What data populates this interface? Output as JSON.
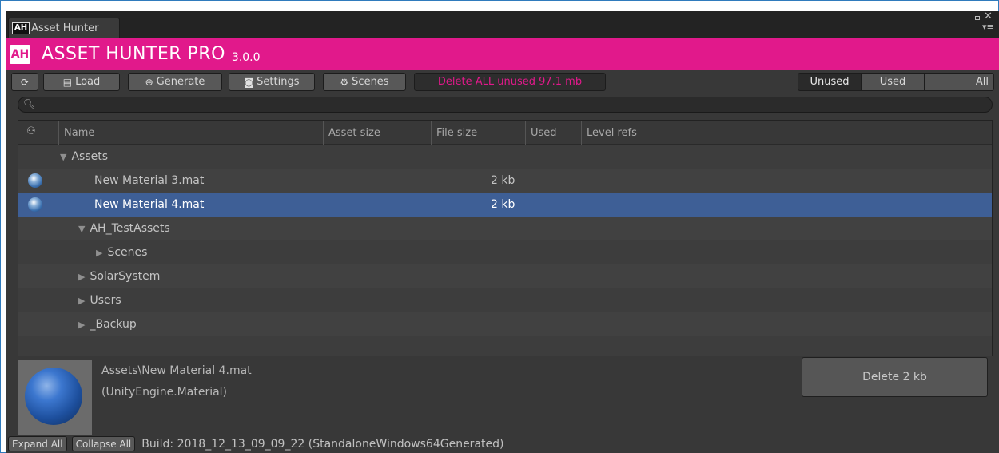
{
  "tab": {
    "badge": "AH",
    "title": "Asset Hunter"
  },
  "header": {
    "logo": "AH",
    "title": "ASSET HUNTER PRO",
    "version": "3.0.0"
  },
  "toolbar": {
    "refresh_icon": "refresh-icon",
    "load_label": "Load",
    "generate_label": "Generate",
    "settings_label": "Settings",
    "scenes_label": "Scenes",
    "delete_all_label": "Delete ALL unused 97.1 mb",
    "filters": [
      {
        "label": "Unused",
        "active": true
      },
      {
        "label": "Used",
        "active": false
      },
      {
        "label": "All",
        "active": false
      }
    ]
  },
  "search": {
    "value": "",
    "placeholder": ""
  },
  "columns": [
    "Name",
    "Asset size",
    "File size",
    "Used",
    "Level refs"
  ],
  "rows": [
    {
      "label": "Assets",
      "expanded": true
    },
    {
      "label": "New Material 3.mat",
      "file_size": "2 kb"
    },
    {
      "label": "New Material 4.mat",
      "file_size": "2 kb",
      "selected": true
    },
    {
      "label": "AH_TestAssets",
      "expanded": true
    },
    {
      "label": "Scenes",
      "expanded": false
    },
    {
      "label": "SolarSystem",
      "expanded": false
    },
    {
      "label": "Users",
      "expanded": false
    },
    {
      "label": "_Backup",
      "expanded": false
    }
  ],
  "selection": {
    "path": "Assets\\New Material 4.mat",
    "type": "(UnityEngine.Material)",
    "delete_label": "Delete 2 kb"
  },
  "footer": {
    "expand_label": "Expand All",
    "collapse_label": "Collapse All",
    "build_info": "Build: 2018_12_13_09_09_22 (StandaloneWindows64Generated)"
  },
  "colors": {
    "accent": "#e1198b",
    "selection": "#3e5f96",
    "panel": "#383838"
  }
}
